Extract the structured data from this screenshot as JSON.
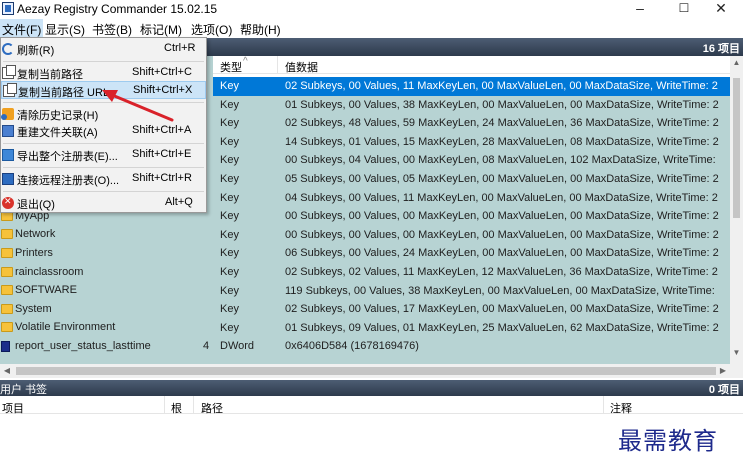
{
  "window": {
    "title": "Aezay Registry Commander 15.02.15",
    "minimize": "–",
    "maximize": "☐",
    "close": "✕"
  },
  "menubar": [
    {
      "label": "文件(F)",
      "active": true
    },
    {
      "label": "显示(S)"
    },
    {
      "label": "书签(B)"
    },
    {
      "label": "标记(M)"
    },
    {
      "label": "选项(O)"
    },
    {
      "label": "帮助(H)"
    }
  ],
  "main_pane": {
    "count": "16 项目",
    "columns": {
      "type": "类型",
      "data": "值数据"
    }
  },
  "file_menu": [
    {
      "label": "刷新(R)",
      "shortcut": "Ctrl+R",
      "icon": "refresh-icon"
    },
    {
      "label": "复制当前路径",
      "shortcut": "Shift+Ctrl+C",
      "icon": "copy-icon"
    },
    {
      "label": "复制当前路径 URL",
      "shortcut": "Shift+Ctrl+X",
      "icon": "copy-icon",
      "highlight": true
    },
    {
      "label": "清除历史记录(H)",
      "shortcut": "",
      "icon": "clear-icon"
    },
    {
      "label": "重建文件关联(A)",
      "shortcut": "Shift+Ctrl+A",
      "icon": "assoc-icon"
    },
    {
      "label": "导出整个注册表(E)...",
      "shortcut": "Shift+Ctrl+E",
      "icon": "export-icon"
    },
    {
      "label": "连接远程注册表(O)...",
      "shortcut": "Shift+Ctrl+R",
      "icon": "remote-icon"
    },
    {
      "label": "退出(Q)",
      "shortcut": "Alt+Q",
      "icon": "exit-icon"
    }
  ],
  "tree_items": [
    {
      "name": "MyApp",
      "icon": "folder-icon"
    },
    {
      "name": "Network",
      "icon": "folder-icon"
    },
    {
      "name": "Printers",
      "icon": "folder-icon"
    },
    {
      "name": "rainclassroom",
      "icon": "folder-icon"
    },
    {
      "name": "SOFTWARE",
      "icon": "folder-icon"
    },
    {
      "name": "System",
      "icon": "folder-icon"
    },
    {
      "name": "Volatile Environment",
      "icon": "folder-icon"
    },
    {
      "name": "report_user_status_lasttime",
      "icon": "dword-icon",
      "num": "4"
    }
  ],
  "value_rows": [
    {
      "type": "Key",
      "value": "02 Subkeys, 00 Values, 11 MaxKeyLen, 00 MaxValueLen, 00 MaxDataSize, WriteTime: 2",
      "selected": true
    },
    {
      "type": "Key",
      "value": "01 Subkeys, 00 Values, 38 MaxKeyLen, 00 MaxValueLen, 00 MaxDataSize, WriteTime: 2"
    },
    {
      "type": "Key",
      "value": "02 Subkeys, 48 Values, 59 MaxKeyLen, 24 MaxValueLen, 36 MaxDataSize, WriteTime: 2"
    },
    {
      "type": "Key",
      "value": "14 Subkeys, 01 Values, 15 MaxKeyLen, 28 MaxValueLen, 08 MaxDataSize, WriteTime: 2"
    },
    {
      "type": "Key",
      "value": "00 Subkeys, 04 Values, 00 MaxKeyLen, 08 MaxValueLen, 102 MaxDataSize, WriteTime:"
    },
    {
      "type": "Key",
      "value": "05 Subkeys, 00 Values, 05 MaxKeyLen, 00 MaxValueLen, 00 MaxDataSize, WriteTime: 2"
    },
    {
      "type": "Key",
      "value": "04 Subkeys, 00 Values, 11 MaxKeyLen, 00 MaxValueLen, 00 MaxDataSize, WriteTime: 2"
    },
    {
      "type": "Key",
      "value": "00 Subkeys, 00 Values, 00 MaxKeyLen, 00 MaxValueLen, 00 MaxDataSize, WriteTime: 2"
    },
    {
      "type": "Key",
      "value": "00 Subkeys, 00 Values, 00 MaxKeyLen, 00 MaxValueLen, 00 MaxDataSize, WriteTime: 2"
    },
    {
      "type": "Key",
      "value": "06 Subkeys, 00 Values, 24 MaxKeyLen, 00 MaxValueLen, 00 MaxDataSize, WriteTime: 2"
    },
    {
      "type": "Key",
      "value": "02 Subkeys, 02 Values, 11 MaxKeyLen, 12 MaxValueLen, 36 MaxDataSize, WriteTime: 2"
    },
    {
      "type": "Key",
      "value": "119 Subkeys, 00 Values, 38 MaxKeyLen, 00 MaxValueLen, 00 MaxDataSize, WriteTime:"
    },
    {
      "type": "Key",
      "value": "02 Subkeys, 00 Values, 17 MaxKeyLen, 00 MaxValueLen, 00 MaxDataSize, WriteTime: 2"
    },
    {
      "type": "Key",
      "value": "01 Subkeys, 09 Values, 01 MaxKeyLen, 25 MaxValueLen, 62 MaxDataSize, WriteTime: 2"
    },
    {
      "type": "DWord",
      "value": "0x6406D584 (1678169476)"
    }
  ],
  "bookmark_pane": {
    "title": "用户 书签",
    "count": "0 项目",
    "columns": {
      "item": "项目",
      "root": "根",
      "path": "路径",
      "note": "注释"
    }
  },
  "watermark": "最需教育",
  "colors": {
    "grid_bg": "#b7d3d3",
    "selection": "#0078d7",
    "header_bg": "#3b4a5f",
    "arrow": "#d9222a"
  }
}
